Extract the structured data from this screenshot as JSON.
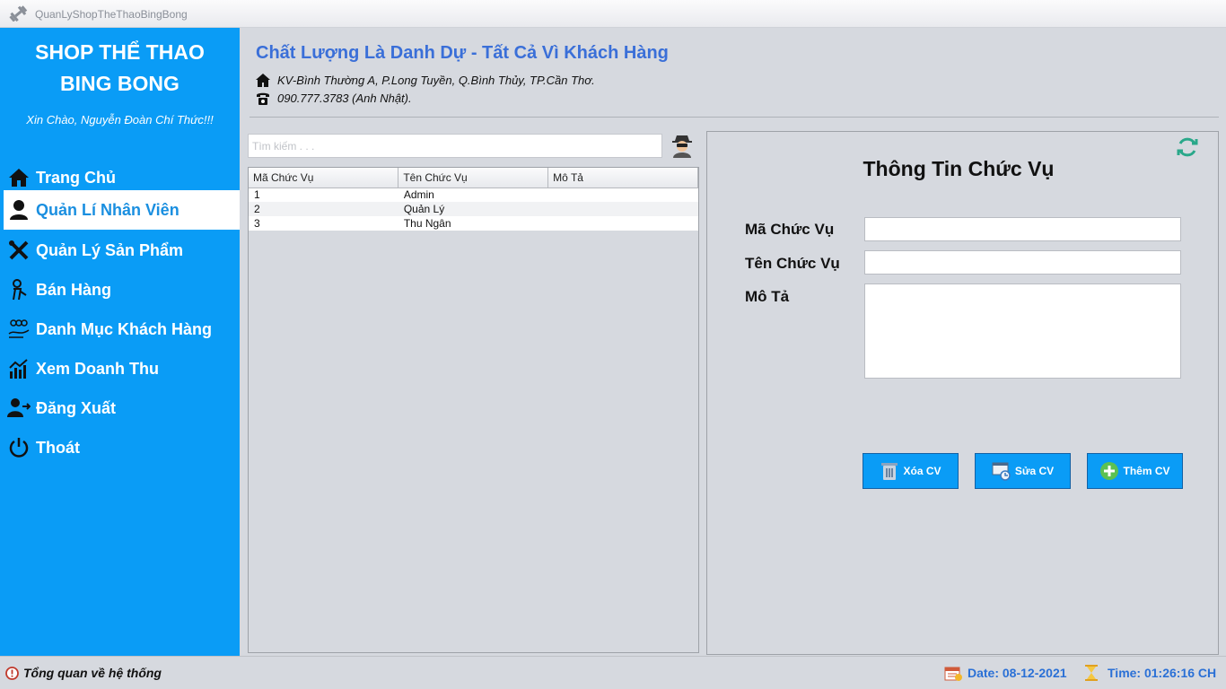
{
  "window": {
    "title": "QuanLyShopTheThaoBingBong"
  },
  "sidebar": {
    "brand_line1": "SHOP THỂ THAO",
    "brand_line2": "BING BONG",
    "greeting": "Xin Chào, Nguyễn Đoàn Chí Thức!!!",
    "items": [
      {
        "label": "Trang Chủ",
        "icon": "home-icon"
      },
      {
        "label": "Quản Lí Nhân Viên",
        "icon": "user-icon",
        "active": true
      },
      {
        "label": "Quản Lý Sản Phẩm",
        "icon": "tools-icon"
      },
      {
        "label": "Bán Hàng",
        "icon": "seller-icon"
      },
      {
        "label": "Danh Mục Khách Hàng",
        "icon": "customers-icon"
      },
      {
        "label": "Xem Doanh Thu",
        "icon": "chart-icon"
      },
      {
        "label": "Đăng Xuất",
        "icon": "logout-icon"
      },
      {
        "label": "Thoát",
        "icon": "power-icon"
      }
    ]
  },
  "header": {
    "slogan": "Chất Lượng Là Danh Dự - Tất Cả Vì Khách Hàng",
    "address": "KV-Bình Thường A, P.Long Tuyền, Q.Bình Thủy, TP.Cần Thơ.",
    "phone": "090.777.3783 (Anh Nhật)."
  },
  "search": {
    "placeholder": "Tìm kiếm . . ."
  },
  "table": {
    "columns": [
      "Mã Chức Vụ",
      "Tên Chức Vụ",
      "Mô Tả"
    ],
    "rows": [
      [
        "1",
        "Admin",
        ""
      ],
      [
        "2",
        "Quản Lý",
        ""
      ],
      [
        "3",
        "Thu Ngân",
        ""
      ]
    ]
  },
  "form": {
    "title": "Thông Tin Chức Vụ",
    "label_id": "Mã Chức Vụ",
    "label_name": "Tên Chức Vụ",
    "label_desc": "Mô Tả",
    "value_id": "",
    "value_name": "",
    "value_desc": "",
    "buttons": {
      "delete": "Xóa CV",
      "edit": "Sửa CV",
      "add": "Thêm CV"
    }
  },
  "status": {
    "left": "Tổng quan về hệ thống",
    "date": "Date: 08-12-2021",
    "time": "Time: 01:26:16 CH"
  },
  "colors": {
    "sidebar": "#0a9cf6",
    "accent_text": "#3a6fd8",
    "status_text": "#2a70d6"
  }
}
